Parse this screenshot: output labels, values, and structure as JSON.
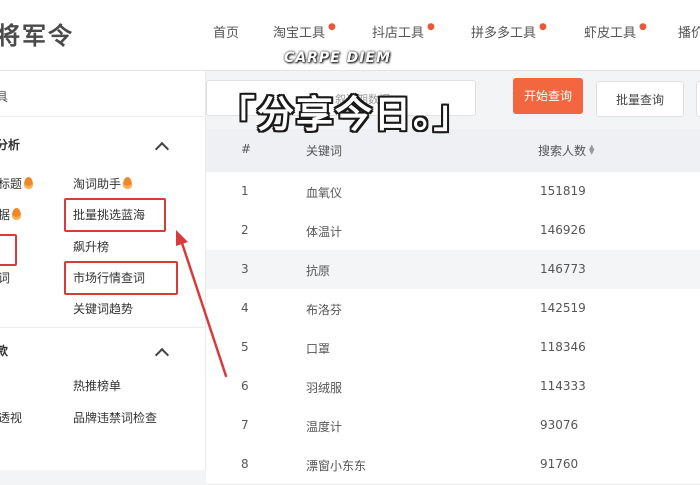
{
  "header": {
    "logo": "将军令",
    "nav": [
      {
        "label": "首页",
        "has_dot": false
      },
      {
        "label": "淘宝工具",
        "has_dot": true
      },
      {
        "label": "抖店工具",
        "has_dot": true
      },
      {
        "label": "拼多多工具",
        "has_dot": true
      },
      {
        "label": "虾皮工具",
        "has_dot": true
      },
      {
        "label": "播价",
        "has_dot": false
      }
    ]
  },
  "sidebar": {
    "search_label": "具",
    "section1": {
      "title": "分析",
      "items": {
        "title_tool": "标题",
        "word_helper": "淘词助手",
        "data": "据",
        "batch_blue_ocean": "批量挑选蓝海",
        "soaring_list": "飙升榜",
        "word": "词",
        "market_query": "市场行情查词",
        "keyword_trend": "关键词趋势"
      }
    },
    "section2": {
      "title": "款",
      "items": {
        "hot_list": "热推榜单",
        "perspective": "透视",
        "brand_check": "品牌违禁词检查"
      }
    }
  },
  "toolbar": {
    "search_placeholder": "叙近期数据",
    "start_query": "开始查询",
    "batch_query": "批量查询"
  },
  "table": {
    "columns": [
      "#",
      "关键词",
      "搜索人数"
    ],
    "rows": [
      {
        "index": "1",
        "keyword": "血氧仪",
        "searches": "151819"
      },
      {
        "index": "2",
        "keyword": "体温计",
        "searches": "146926"
      },
      {
        "index": "3",
        "keyword": "抗原",
        "searches": "146773"
      },
      {
        "index": "4",
        "keyword": "布洛芬",
        "searches": "142519"
      },
      {
        "index": "5",
        "keyword": "口罩",
        "searches": "118346"
      },
      {
        "index": "6",
        "keyword": "羽绒服",
        "searches": "114333"
      },
      {
        "index": "7",
        "keyword": "温度计",
        "searches": "93076"
      },
      {
        "index": "8",
        "keyword": "漂窗小东东",
        "searches": "91760"
      }
    ]
  },
  "overlay": {
    "subtitle": "CARPE DIEM",
    "headline": "「分享今日。」"
  },
  "colors": {
    "accent": "#f2673f",
    "annotation_red": "#d93a3a",
    "header_bg": "#eef0f3"
  }
}
